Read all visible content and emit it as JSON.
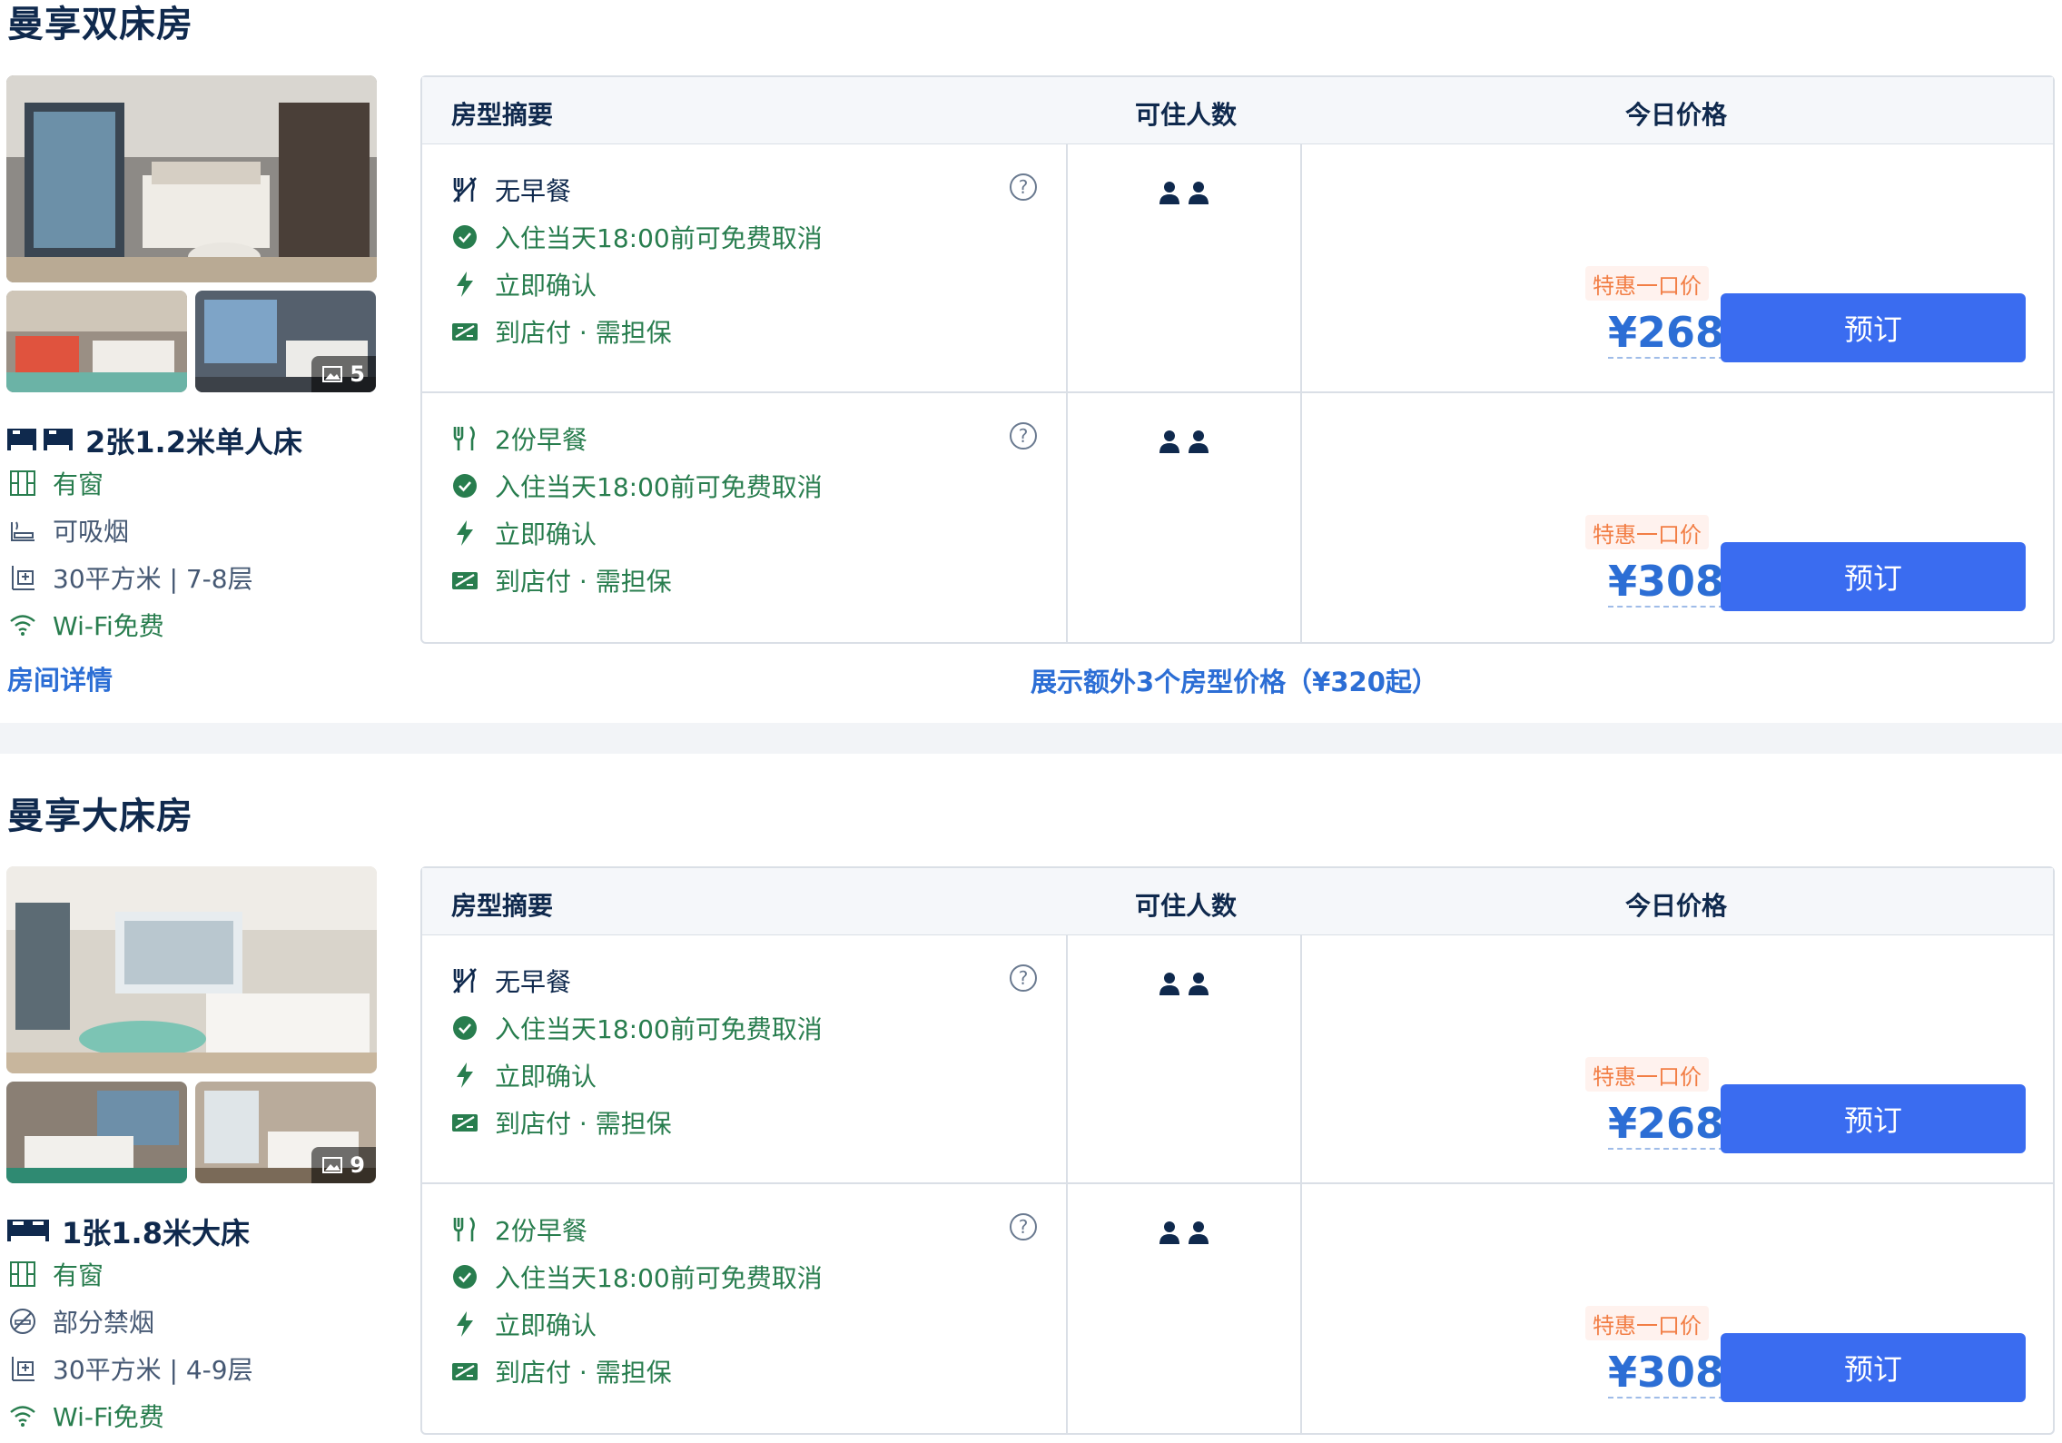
{
  "headers": {
    "summary": "房型摘要",
    "guests": "可住人数",
    "price": "今日价格"
  },
  "rooms": [
    {
      "title": "曼享双床房",
      "photo_count": "5",
      "bed": "2张1.2米单人床",
      "features": {
        "window": "有窗",
        "smoking": "可吸烟",
        "area": "30平方米 | 7-8层",
        "wifi": "Wi-Fi免费"
      },
      "detail_link": "房间详情",
      "more_link": "展示额外3个房型价格（¥320起）",
      "offers": [
        {
          "meal": "无早餐",
          "cancel": "入住当天18:00前可免费取消",
          "confirm": "立即确认",
          "pay": "到店付 · 需担保",
          "promo": "特惠一口价",
          "price": "¥268",
          "book": "预订"
        },
        {
          "meal": "2份早餐",
          "cancel": "入住当天18:00前可免费取消",
          "confirm": "立即确认",
          "pay": "到店付 · 需担保",
          "promo": "特惠一口价",
          "price": "¥308",
          "book": "预订"
        }
      ]
    },
    {
      "title": "曼享大床房",
      "photo_count": "9",
      "bed": "1张1.8米大床",
      "features": {
        "window": "有窗",
        "smoking": "部分禁烟",
        "area": "30平方米 | 4-9层",
        "wifi": "Wi-Fi免费"
      },
      "offers": [
        {
          "meal": "无早餐",
          "cancel": "入住当天18:00前可免费取消",
          "confirm": "立即确认",
          "pay": "到店付 · 需担保",
          "promo": "特惠一口价",
          "price": "¥268",
          "book": "预订"
        },
        {
          "meal": "2份早餐",
          "cancel": "入住当天18:00前可免费取消",
          "confirm": "立即确认",
          "pay": "到店付 · 需担保",
          "promo": "特惠一口价",
          "price": "¥308",
          "book": "预订"
        }
      ]
    }
  ],
  "colors": {
    "accent_blue": "#2c6ed5",
    "button_blue": "#3a6cf0",
    "green": "#287d4e",
    "promo_orange": "#f27e45"
  },
  "icons": [
    "no-breakfast-icon",
    "breakfast-icon",
    "check-circle-icon",
    "lightning-icon",
    "pay-at-hotel-icon",
    "help-icon",
    "guest-icon",
    "bed-icon",
    "window-icon",
    "smoking-icon",
    "no-smoking-icon",
    "area-icon",
    "wifi-icon",
    "photo-icon"
  ]
}
